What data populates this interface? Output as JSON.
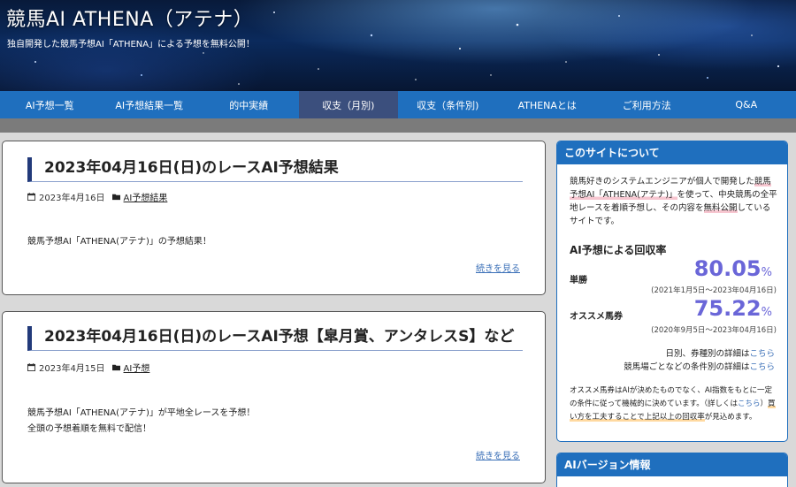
{
  "header": {
    "site_title": "競馬AI ATHENA（アテナ）",
    "site_description": "独自開発した競馬予想AI「ATHENA」による予想を無料公開！"
  },
  "nav": {
    "items": [
      {
        "label": "AI予想一覧"
      },
      {
        "label": "AI予想結果一覧"
      },
      {
        "label": "的中実績"
      },
      {
        "label": "収支（月別)"
      },
      {
        "label": "収支（条件別)"
      },
      {
        "label": "ATHENAとは"
      },
      {
        "label": "ご利用方法"
      },
      {
        "label": "Q&A"
      }
    ],
    "active_index": 3
  },
  "posts": [
    {
      "title": "2023年04月16日(日)のレースAI予想結果",
      "date": "2023年4月16日",
      "category": "AI予想結果",
      "excerpt_lines": [
        "競馬予想AI「ATHENA(アテナ)」の予想結果！"
      ],
      "more_label": "続きを見る"
    },
    {
      "title": "2023年04月16日(日)のレースAI予想【皐月賞、アンタレスS】など",
      "date": "2023年4月15日",
      "category": "AI予想",
      "excerpt_lines": [
        "競馬予想AI「ATHENA(アテナ)」が平地全レースを予想！",
        "全頭の予想着順を無料で配信！"
      ],
      "more_label": "続きを見る"
    }
  ],
  "sidebar": {
    "about_heading": "このサイトについて",
    "intro": {
      "part1": "競馬好きのシステムエンジニアが個人で開発した",
      "highlight1": "競馬予想AI「ATHENA(アテナ)」",
      "part2": "を使って、中央競馬の全平地レースを着順予想し、その内容を",
      "highlight2": "無料公開",
      "part3": "しているサイトです。"
    },
    "rate_title": "AI予想による回収率",
    "rates": [
      {
        "label": "単勝",
        "value": "80.05",
        "unit": "%",
        "period": "(2021年1月5日～2023年04月16日)"
      },
      {
        "label": "オススメ馬券",
        "value": "75.22",
        "unit": "%",
        "period": "(2020年9月5日～2023年04月16日)"
      }
    ],
    "detail_lines": [
      {
        "text": "日別、券種別の詳細は",
        "link": "こちら"
      },
      {
        "text": "競馬場ごとなどの条件別の詳細は",
        "link": "こちら"
      }
    ],
    "note": {
      "part1": "オススメ馬券はAIが決めたものでなく、AI指数をもとに一定の条件に従って機械的に決めています。（詳しくは",
      "link": "こちら",
      "part2": "）",
      "highlight": "買い方を工夫することで上記以上の回収率",
      "part3": "が見込めます。"
    },
    "version_heading": "AIバージョン情報"
  },
  "colors": {
    "nav_bg": "#1f6fbe",
    "nav_active": "#3b4f7d",
    "accent_rate": "#6a66d8",
    "title_bar": "#223a7a"
  },
  "icons": [
    "calendar-icon",
    "folder-icon"
  ]
}
